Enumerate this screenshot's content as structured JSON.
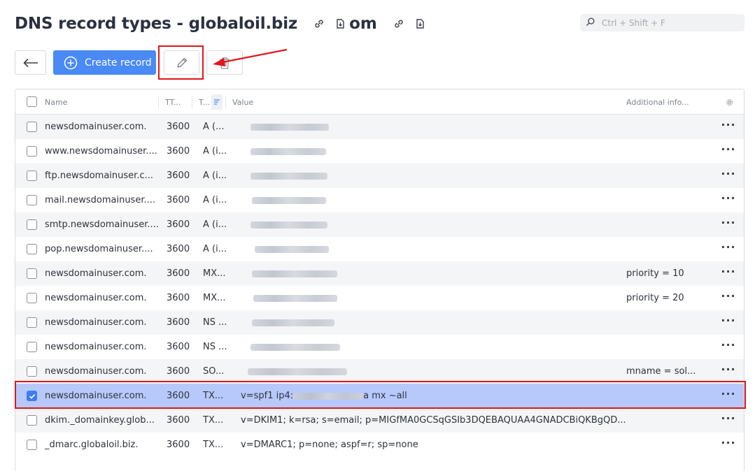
{
  "page": {
    "title": "DNS record types - globaloil.biz",
    "title_suffix": "om",
    "icons": [
      "link-icon",
      "document-download-icon"
    ]
  },
  "search": {
    "placeholder": "Ctrl + Shift + F"
  },
  "toolbar": {
    "create_label": "Create record"
  },
  "table": {
    "columns": [
      "Name",
      "TT...",
      "T...",
      "Value",
      "Additional info..."
    ],
    "rows": [
      {
        "name": "newsdomainuser.com.",
        "ttl": "3600",
        "type": "A (...",
        "value": "",
        "info": ""
      },
      {
        "name": "www.newsdomainuser....",
        "ttl": "3600",
        "type": "A (i...",
        "value": "",
        "info": ""
      },
      {
        "name": "ftp.newsdomainuser.c...",
        "ttl": "3600",
        "type": "A (i...",
        "value": "",
        "info": ""
      },
      {
        "name": "mail.newsdomainuser....",
        "ttl": "3600",
        "type": "A (i...",
        "value": "",
        "info": ""
      },
      {
        "name": "smtp.newsdomainuser....",
        "ttl": "3600",
        "type": "A (i...",
        "value": "",
        "info": ""
      },
      {
        "name": "pop.newsdomainuser....",
        "ttl": "3600",
        "type": "A (i...",
        "value": "",
        "info": ""
      },
      {
        "name": "newsdomainuser.com.",
        "ttl": "3600",
        "type": "MX...",
        "value": "",
        "info": "priority = 10"
      },
      {
        "name": "newsdomainuser.com.",
        "ttl": "3600",
        "type": "MX...",
        "value": "",
        "info": "priority = 20"
      },
      {
        "name": "newsdomainuser.com.",
        "ttl": "3600",
        "type": "NS ...",
        "value": "",
        "info": ""
      },
      {
        "name": "newsdomainuser.com.",
        "ttl": "3600",
        "type": "NS ...",
        "value": "",
        "info": ""
      },
      {
        "name": "newsdomainuser.com.",
        "ttl": "3600",
        "type": "SO...",
        "value": "",
        "info": "mname = sol..."
      },
      {
        "name": "newsdomainuser.com.",
        "ttl": "3600",
        "type": "TX...",
        "value_prefix": "v=spf1 ip4:",
        "value_suffix": "a mx ~all",
        "info": "",
        "selected": true
      },
      {
        "name": "dkim._domainkey.glob...",
        "ttl": "3600",
        "type": "TX...",
        "value": "v=DKIM1; k=rsa; s=email; p=MIGfMA0GCSqGSIb3DQEBAQUAA4GNADCBiQKBgQD...",
        "info": ""
      },
      {
        "name": "_dmarc.globaloil.biz.",
        "ttl": "3600",
        "type": "TX...",
        "value": "v=DMARC1; p=none; aspf=r; sp=none",
        "info": ""
      }
    ]
  },
  "colors": {
    "accent": "#4a8af4",
    "selected_row": "#b7c8fb",
    "highlight": "#e0161b"
  }
}
